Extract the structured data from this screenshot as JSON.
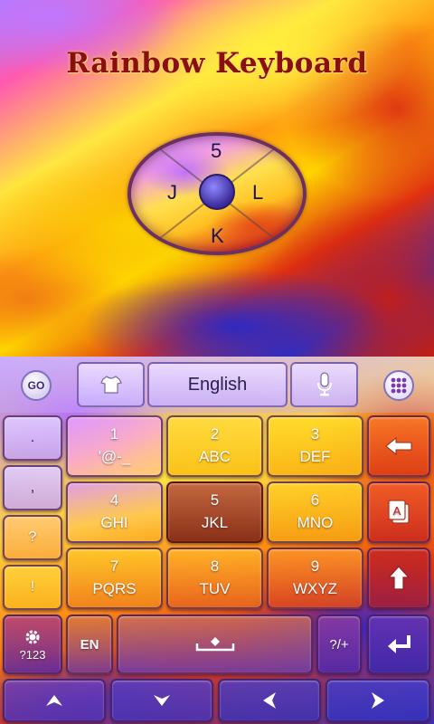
{
  "promo": {
    "title": "Rainbow Keyboard",
    "preview_keys": {
      "top": "5",
      "left": "J",
      "right": "L",
      "bottom": "K"
    }
  },
  "toolbar": {
    "go_label": "GO",
    "shirt_icon": "tshirt-icon",
    "language_label": "English",
    "mic_icon": "microphone-icon",
    "apps_icon": "apps-grid-icon"
  },
  "left_column": [
    ".",
    ",",
    "?",
    "!"
  ],
  "keys": [
    {
      "num": "1",
      "letters": "'@-_"
    },
    {
      "num": "2",
      "letters": "ABC"
    },
    {
      "num": "3",
      "letters": "DEF"
    },
    {
      "num": "4",
      "letters": "GHI"
    },
    {
      "num": "5",
      "letters": "JKL"
    },
    {
      "num": "6",
      "letters": "MNO"
    },
    {
      "num": "7",
      "letters": "PQRS"
    },
    {
      "num": "8",
      "letters": "TUV"
    },
    {
      "num": "9",
      "letters": "WXYZ"
    }
  ],
  "right_column": {
    "backspace_icon": "backspace-arrow-icon",
    "clipboard_icon": "text-edit-icon",
    "shift_icon": "shift-up-icon"
  },
  "bottom_row": {
    "settings_label": "?123",
    "lang_label": "EN",
    "space_icon": "space-icon",
    "symbols_label": "?/+",
    "enter_icon": "enter-icon"
  },
  "nav_row": {
    "up_icon": "arrow-up-icon",
    "down_icon": "arrow-down-icon",
    "left_icon": "arrow-left-icon",
    "right_icon": "arrow-right-icon"
  },
  "colors": {
    "title": "#8a1010",
    "pressed_key": "#a04020"
  }
}
